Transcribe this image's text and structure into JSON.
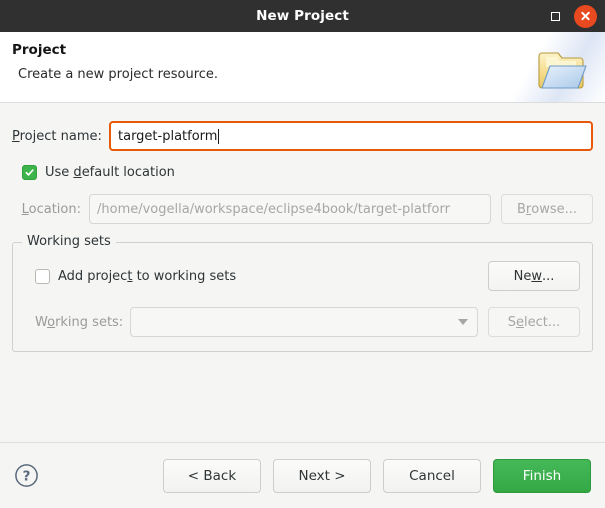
{
  "window": {
    "title": "New Project",
    "maximize_icon": "maximize-icon",
    "close_icon": "close-icon",
    "close_color": "#e8491f",
    "titlebar_color": "#303030"
  },
  "header": {
    "title": "Project",
    "description": "Create a new project resource.",
    "icon": "folder-with-page-icon"
  },
  "form": {
    "project_name": {
      "label_pre": "P",
      "label_mnemonic": "",
      "label": "Project name:",
      "value": "target-platform",
      "focused": true,
      "focus_color": "#e8590c"
    },
    "use_default_location": {
      "label": "Use default location",
      "checked": true,
      "check_color": "#3cb44a",
      "mnemonic": "d"
    },
    "location": {
      "label": "Location:",
      "value": "/home/vogella/workspace/eclipse4book/target-platforr",
      "disabled": true,
      "mnemonic": "L"
    },
    "browse_button": {
      "label": "Browse...",
      "disabled": true,
      "mnemonic": "r"
    }
  },
  "working_sets": {
    "legend": "Working sets",
    "add_project": {
      "label": "Add project to working sets",
      "checked": false,
      "mnemonic": "t"
    },
    "new_button": {
      "label": "New...",
      "disabled": false,
      "mnemonic": "w"
    },
    "sets_label": "Working sets:",
    "sets_value": "",
    "sets_disabled": true,
    "select_button": {
      "label": "Select...",
      "disabled": true,
      "mnemonic": "e"
    }
  },
  "footer": {
    "help_icon": "help-question-icon",
    "buttons": [
      {
        "label": "< Back",
        "name": "back-button",
        "primary": false,
        "disabled": false
      },
      {
        "label": "Next >",
        "name": "next-button",
        "primary": false,
        "disabled": false
      },
      {
        "label": "Cancel",
        "name": "cancel-button",
        "primary": false,
        "disabled": false
      },
      {
        "label": "Finish",
        "name": "finish-button",
        "primary": true,
        "disabled": false
      }
    ],
    "finish_color": "#3cb44a"
  }
}
